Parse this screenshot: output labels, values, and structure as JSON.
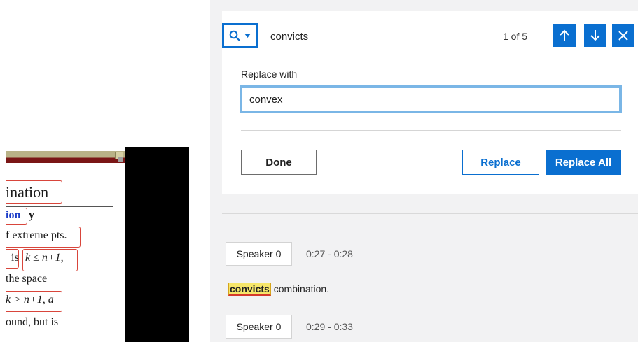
{
  "find_bar": {
    "search_term": "convicts",
    "match_count": "1 of 5",
    "icons": [
      "search-icon",
      "caret-down-icon",
      "arrow-up-icon",
      "arrow-down-icon",
      "close-icon"
    ]
  },
  "replace": {
    "label": "Replace with",
    "value": "convex"
  },
  "buttons": {
    "done": "Done",
    "replace": "Replace",
    "replace_all": "Replace All"
  },
  "transcript": [
    {
      "speaker": "Speaker 0",
      "time": "0:27 - 0:28"
    },
    {
      "speaker": "Speaker 0",
      "time": "0:29 - 0:33"
    }
  ],
  "transcript_text": {
    "highlight": "convicts",
    "rest": " combination."
  },
  "slide": {
    "lines": [
      "ination",
      "ion",
      "y",
      "f extreme pts.",
      "is",
      "k ≤ n+1,",
      "the space",
      "k > n+1, a",
      "ound, but is"
    ]
  },
  "colors": {
    "accent": "#0a6fd0",
    "input_focus": "#7ab6e6",
    "highlight": "#f6e66a",
    "annotation": "#d8453b"
  }
}
